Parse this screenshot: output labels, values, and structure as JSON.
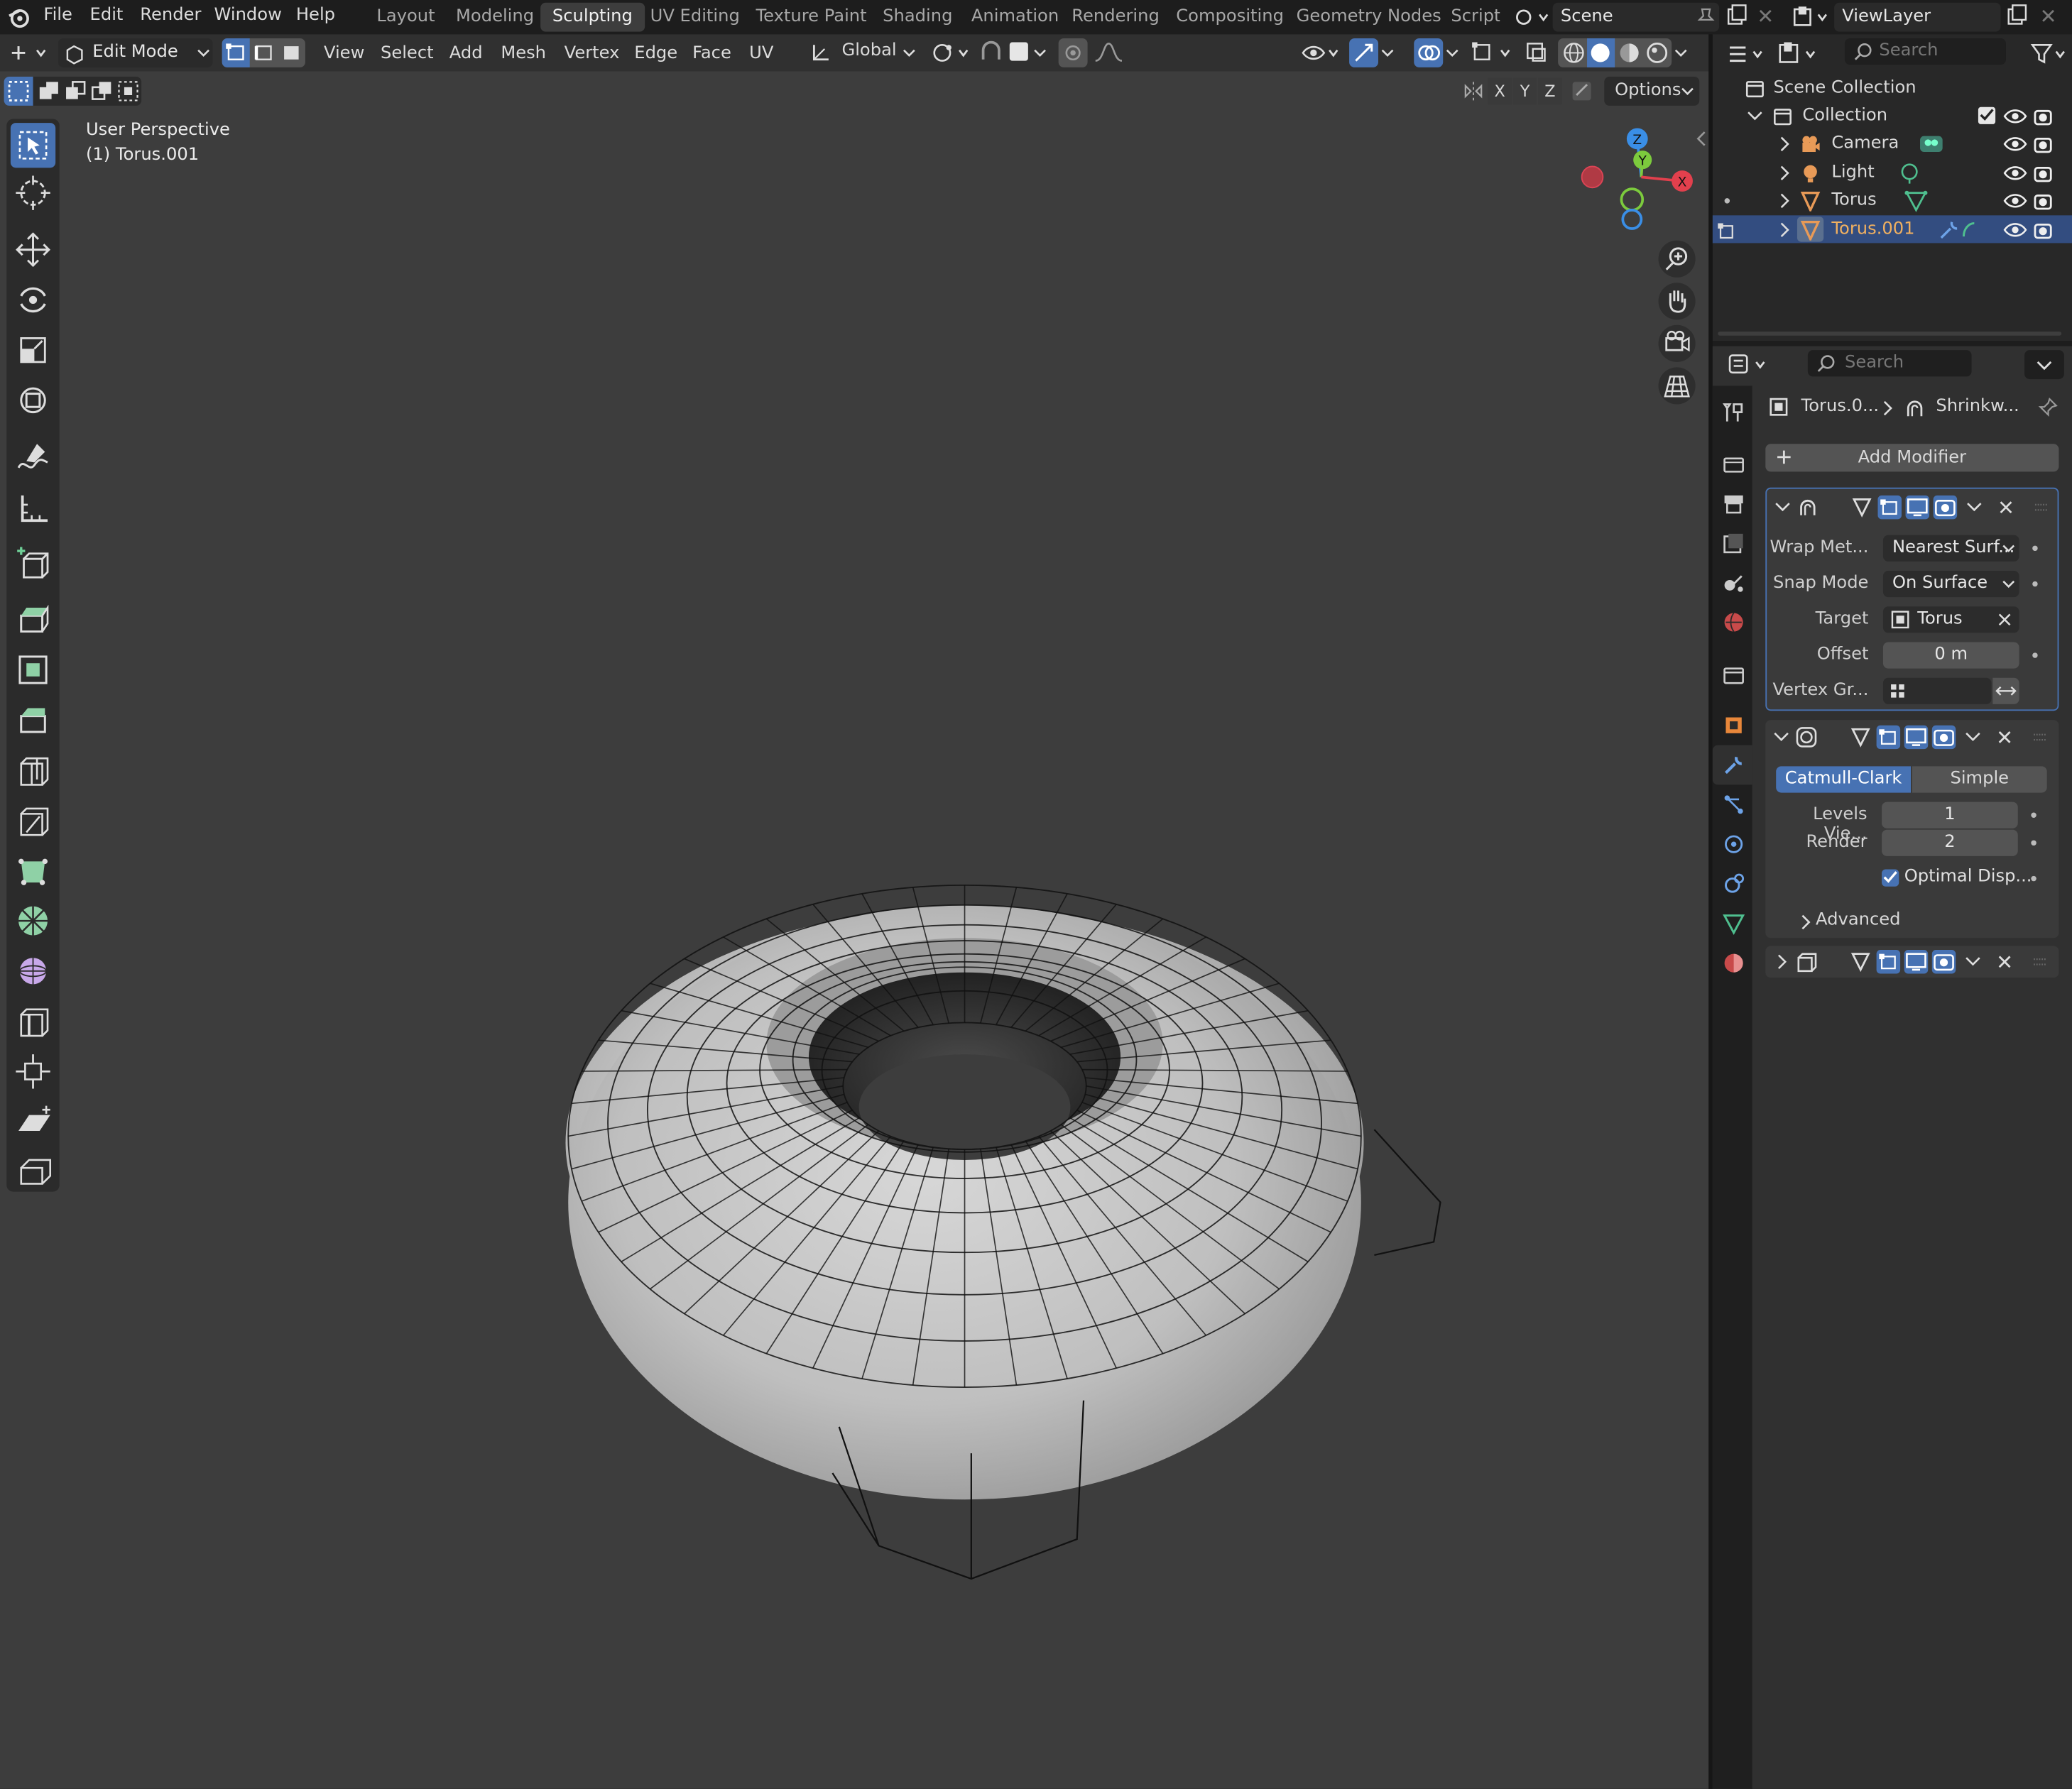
{
  "topbar": {
    "menus": [
      "File",
      "Edit",
      "Render",
      "Window",
      "Help"
    ],
    "workspaces": [
      "Layout",
      "Modeling",
      "Sculpting",
      "UV Editing",
      "Texture Paint",
      "Shading",
      "Animation",
      "Rendering",
      "Compositing",
      "Geometry Nodes",
      "Scripti"
    ],
    "active_workspace": "Sculpting",
    "scene": "Scene",
    "view_layer": "ViewLayer"
  },
  "header": {
    "mode": "Edit Mode",
    "menus": [
      "View",
      "Select",
      "Add",
      "Mesh",
      "Vertex",
      "Edge",
      "Face",
      "UV"
    ],
    "orientation": "Global",
    "axes": [
      "X",
      "Y",
      "Z"
    ],
    "options": "Options"
  },
  "viewport": {
    "view_name": "User Perspective",
    "object_name": "(1) Torus.001",
    "gizmo_axes": [
      "Z",
      "Y",
      "X"
    ]
  },
  "outliner": {
    "search_placeholder": "Search",
    "scene_collection": "Scene Collection",
    "collection": "Collection",
    "items": [
      {
        "name": "Camera",
        "icon": "camera-icon",
        "color": "#e89a57"
      },
      {
        "name": "Light",
        "icon": "light-icon",
        "color": "#e89a57"
      },
      {
        "name": "Torus",
        "icon": "mesh-icon",
        "color": "#e89a57"
      },
      {
        "name": "Torus.001",
        "icon": "mesh-icon",
        "color": "#e89a57",
        "selected": true
      }
    ]
  },
  "properties": {
    "search_placeholder": "Search",
    "breadcrumb_object": "Torus.0...",
    "breadcrumb_modifier": "Shrinkw...",
    "add_modifier": "Add Modifier",
    "shrinkwrap": {
      "wrap_method_label": "Wrap Met...",
      "wrap_method_value": "Nearest Surf...",
      "snap_mode_label": "Snap Mode",
      "snap_mode_value": "On Surface",
      "target_label": "Target",
      "target_value": "Torus",
      "offset_label": "Offset",
      "offset_value": "0 m",
      "vertex_group_label": "Vertex Gr..."
    },
    "subdivision": {
      "catmull": "Catmull-Clark",
      "simple": "Simple",
      "levels_label": "Levels Vie...",
      "levels_value": "1",
      "render_label": "Render",
      "render_value": "2",
      "optimal_label": "Optimal Disp...",
      "optimal_checked": true,
      "advanced": "Advanced"
    }
  },
  "colors": {
    "accent": "#4772b3",
    "selected_row": "#334d80",
    "viewport_bg": "#3d3d3d"
  }
}
